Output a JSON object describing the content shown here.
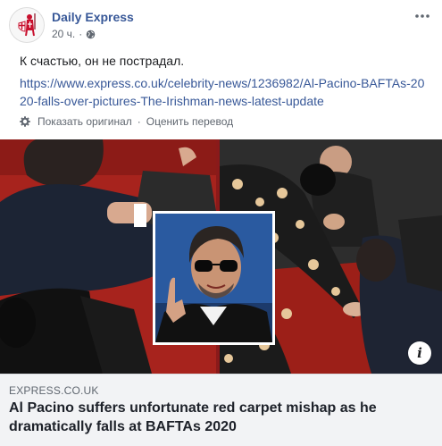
{
  "post": {
    "page_name": "Daily Express",
    "time": "20 ч.",
    "dot": "·",
    "caption": "К счастью, он не пострадал.",
    "link_url": "https://www.express.co.uk/celebrity-news/1236982/Al-Pacino-BAFTAs-2020-falls-over-pictures-The-Irishman-news-latest-update",
    "show_original": "Показать оригинал",
    "separator": "·",
    "rate_translation": "Оценить перевод"
  },
  "link_card": {
    "domain": "EXPRESS.CO.UK",
    "headline": "Al Pacino suffers unfortunate red carpet mishap as he dramatically falls at BAFTAs 2020"
  },
  "icons": {
    "avatar": "daily-express-crusader-logo",
    "privacy": "globe-icon",
    "more": "more-options-icon",
    "settings": "gear-icon",
    "info": "info-icon"
  },
  "colors": {
    "link": "#385898",
    "meta": "#606770",
    "card_bg": "#f2f3f5",
    "red_carpet": "#b3261e"
  }
}
